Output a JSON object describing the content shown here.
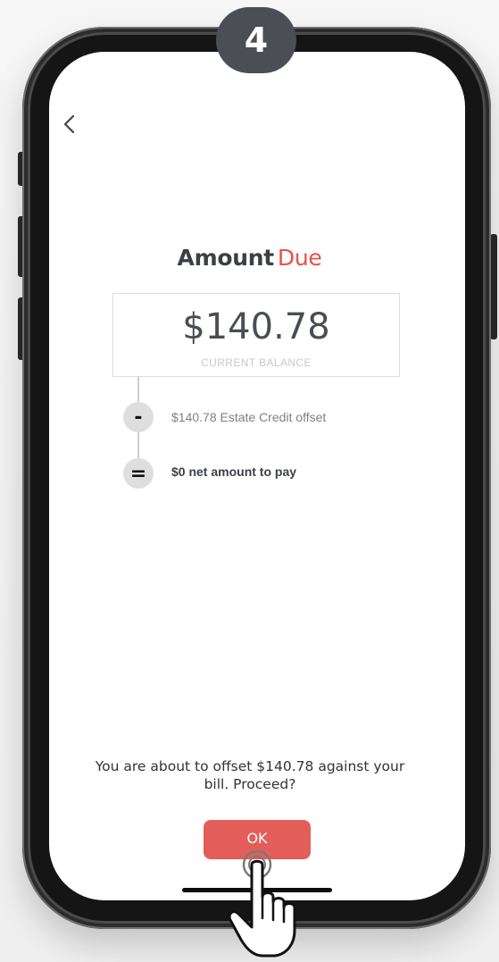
{
  "step": {
    "number": "4"
  },
  "header": {
    "title_part1": "Amount",
    "title_part2": "Due"
  },
  "balance": {
    "amount": "$140.78",
    "label": "CURRENT BALANCE"
  },
  "breakdown": [
    {
      "operator": "-",
      "text": "$140.78 Estate Credit offset"
    },
    {
      "operator": "=",
      "text": "$0 net amount to pay"
    }
  ],
  "confirm": {
    "line1": "You are about to offset $140.78 against your",
    "line2": "bill. Proceed?",
    "ok_label": "OK"
  },
  "icons": {
    "back": "chevron-left-icon",
    "cursor": "hand-pointer-icon"
  },
  "colors": {
    "accent": "#e9504a",
    "button": "#e35e58",
    "badge": "#4b4e55"
  }
}
